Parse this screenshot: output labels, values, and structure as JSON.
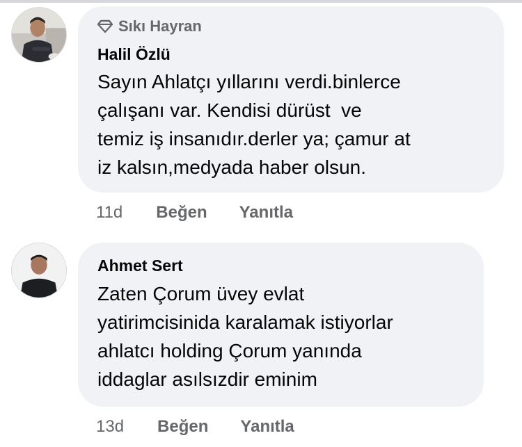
{
  "comments": [
    {
      "badge": "Sıkı Hayran",
      "badge_icon": "diamond-icon",
      "author": "Halil Özlü",
      "text_lines": [
        "Sayın Ahlatçı yıllarını verdi.binlerce",
        "çalışanı var. Kendisi dürüst  ve",
        "temiz iş insanıdır.derler ya; çamur at",
        "iz kalsın,medyada haber olsun."
      ],
      "time": "11d",
      "like_label": "Beğen",
      "reply_label": "Yanıtla"
    },
    {
      "author": "Ahmet Sert",
      "text_lines": [
        "Zaten Çorum üvey evlat",
        "yatirimcisinida karalamak istiyorlar",
        "ahlatcı holding Çorum yanında",
        "iddaglar asılsızdir eminim"
      ],
      "time": "13d",
      "like_label": "Beğen",
      "reply_label": "Yanıtla"
    }
  ],
  "colors": {
    "bubble": "#f0f2f5",
    "meta_text": "#65676b",
    "primary_text": "#050505"
  }
}
